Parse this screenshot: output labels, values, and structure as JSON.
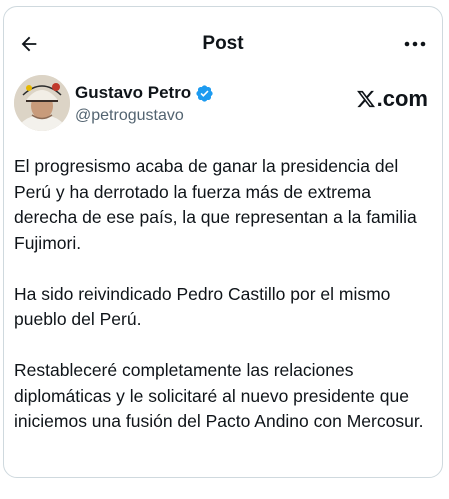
{
  "header": {
    "title": "Post"
  },
  "author": {
    "display_name": "Gustavo Petro",
    "handle": "@petrogustavo",
    "verified": true,
    "verified_color": "#1d9bf0"
  },
  "brand": {
    "label": ".com"
  },
  "post": {
    "paragraphs": [
      "El progresismo acaba de ganar la presidencia del Perú y ha derrotado la fuerza más de extrema derecha de ese país, la que representan a la familia Fujimori.",
      "Ha sido reivindicado Pedro Castillo por el mismo pueblo del Perú.",
      "Restableceré completamente las relaciones diplomáticas y le solicitaré al nuevo presidente que iniciemos una fusión del Pacto Andino con Mercosur."
    ]
  },
  "icons": {
    "back": "arrow-left-icon",
    "more": "more-horizontal-icon",
    "verified": "verified-badge-icon",
    "brand": "x-logo-icon"
  }
}
